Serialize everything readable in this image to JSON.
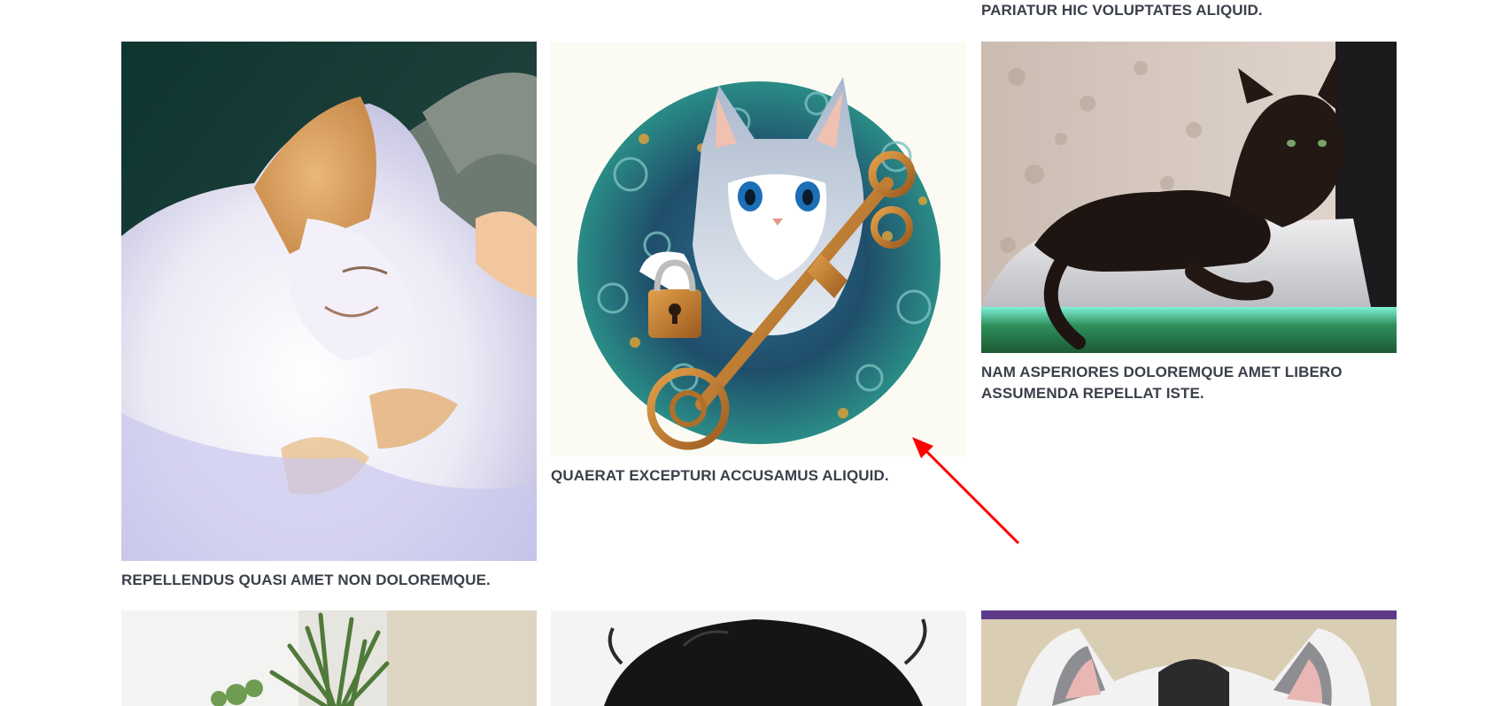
{
  "gallery": {
    "top_caption": "PARIATUR HIC VOLUPTATES ALIQUID.",
    "cards": [
      {
        "image": "sleeping-orange-white-cat-photo",
        "caption": "REPELLENDUS QUASI AMET NON DOLOREMQUE."
      },
      {
        "image": "cat-with-padlock-and-key-illustration",
        "caption": "QUAERAT EXCEPTURI ACCUSAMUS ALIQUID."
      },
      {
        "image": "black-cat-on-aquarium-photo",
        "caption": "NAM ASPERIORES DOLOREMQUE AMET LIBERO ASSUMENDA REPELLAT ISTE."
      },
      {
        "image": "potted-plants-photo",
        "caption": ""
      },
      {
        "image": "black-fluffy-cat-photo",
        "caption": ""
      },
      {
        "image": "white-grey-cat-ears-photo",
        "caption": ""
      }
    ]
  },
  "overlay": {
    "annotation": "red-arrow-pointer",
    "color": "#ff0000"
  }
}
